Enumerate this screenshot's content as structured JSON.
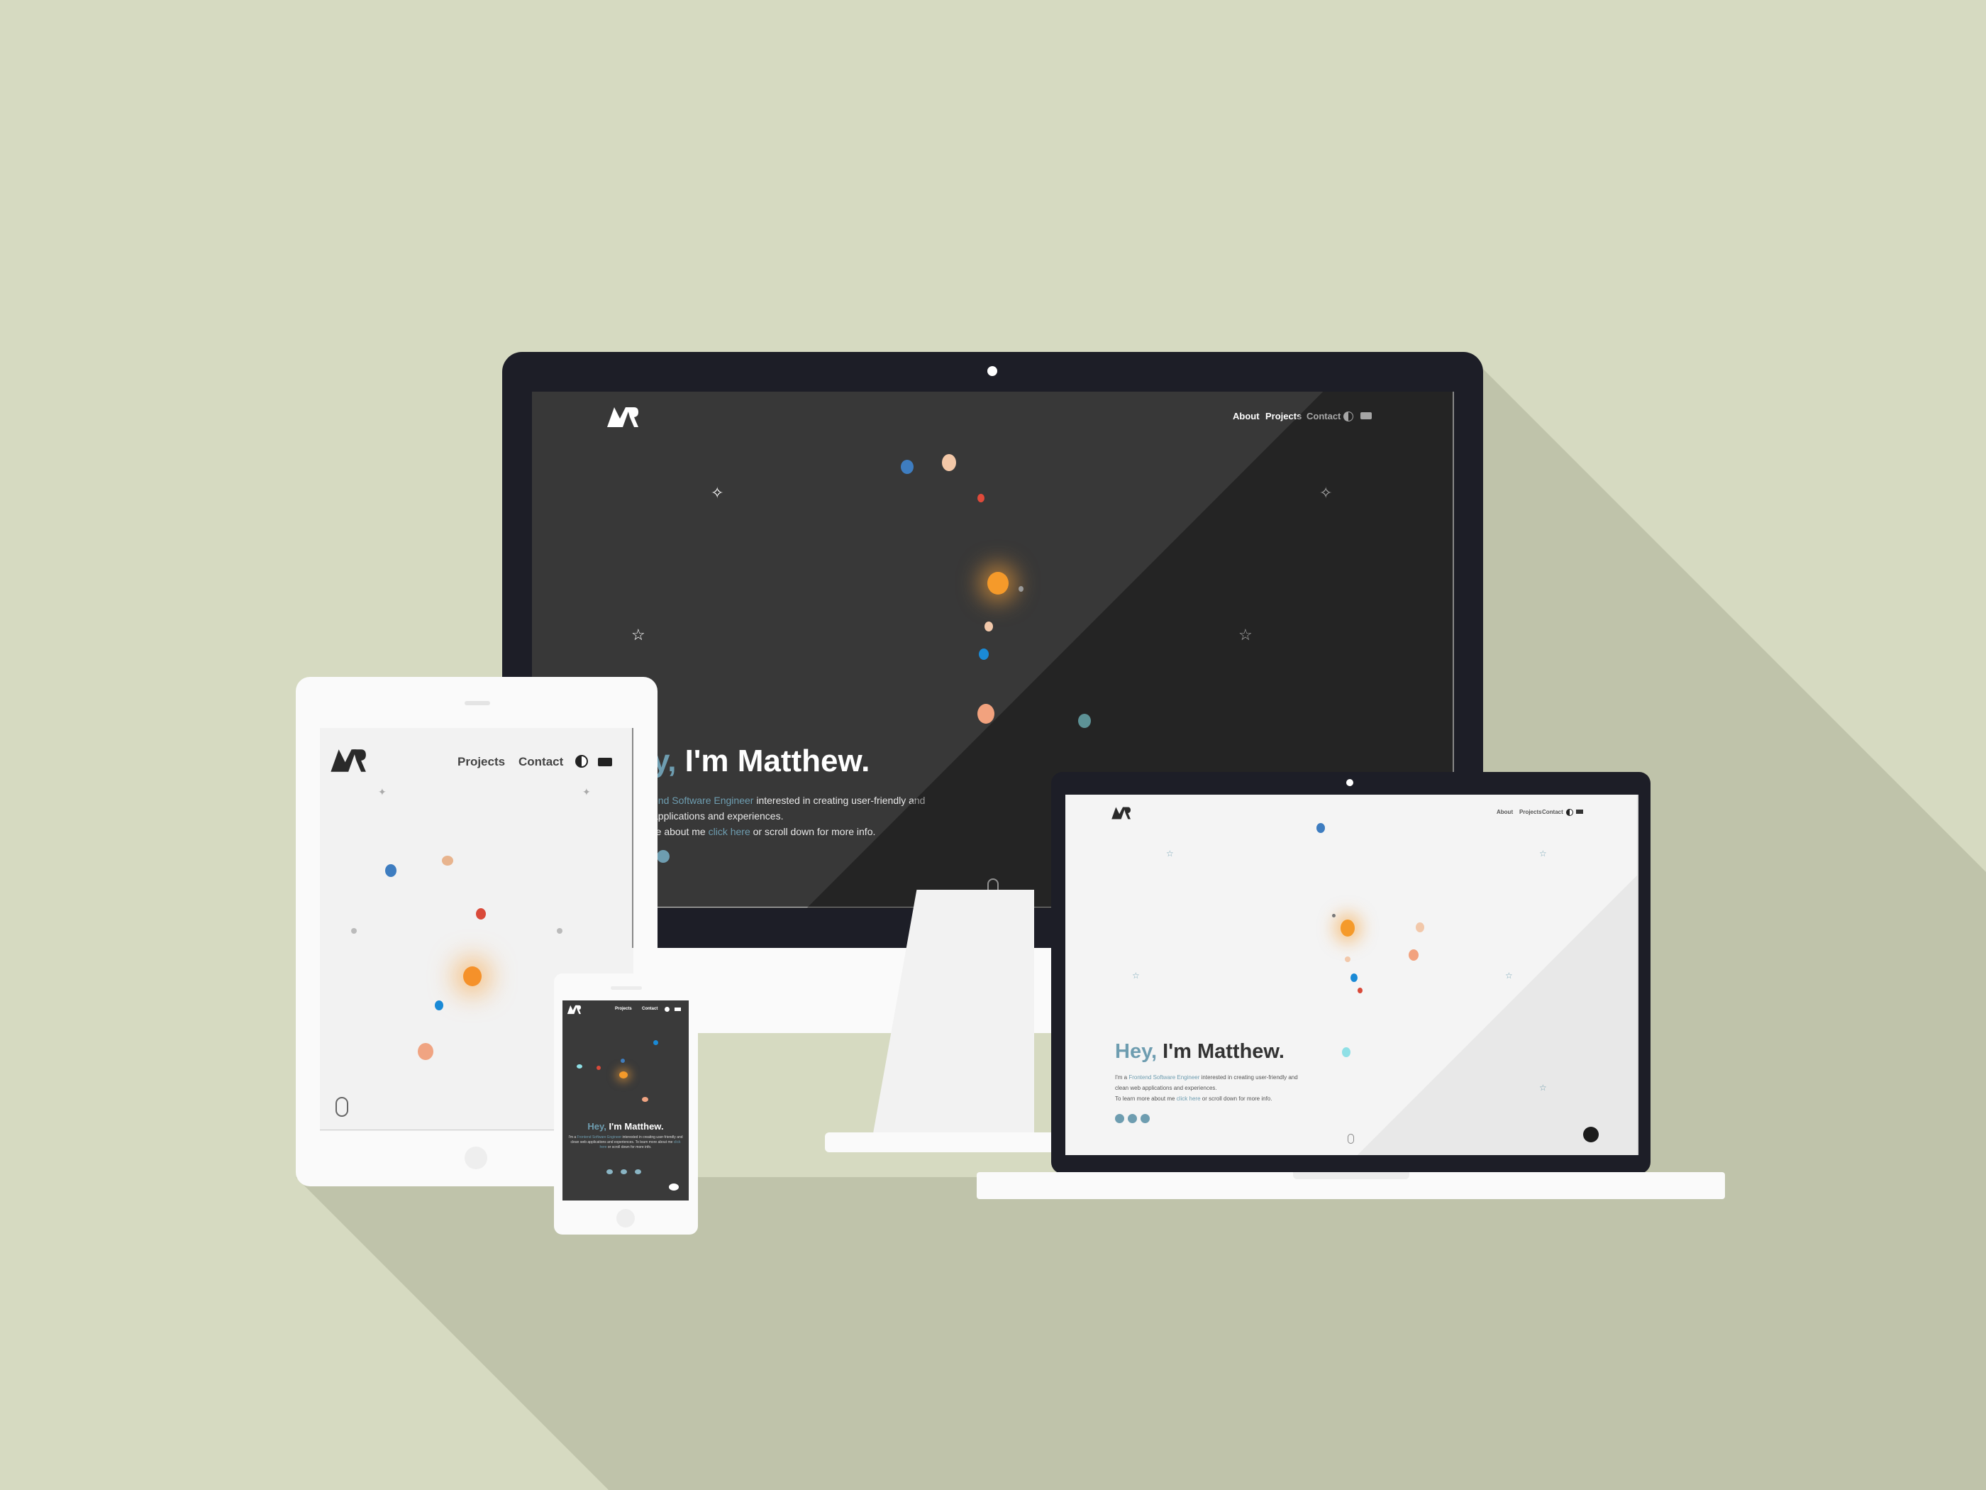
{
  "colors": {
    "background": "#d6dac1",
    "shadow": "#bfc3aa",
    "bezel": "#1d1e27",
    "accent": "#6e9db0",
    "sun": "#f7a13a"
  },
  "logo": {
    "text": "MR"
  },
  "nav": {
    "about": "About",
    "projects": "Projects",
    "contact": "Contact",
    "theme_icon": "contrast-icon",
    "lang_icon": "language-icon"
  },
  "hero": {
    "greeting": "Hey,",
    "name": "I'm Matthew.",
    "line1_prefix": "I'm a",
    "role": "Frontend Software Engineer",
    "line1_suffix": "interested in creating user-friendly and",
    "line2": "clean web applications and experiences.",
    "line3_prefix": "To learn more about me",
    "link": "click here",
    "line3_suffix": "or scroll down for more info."
  },
  "monitor_hero": {
    "greeting_partial": "y,",
    "line1_prefix": "",
    "role_partial": "end Software Engineer",
    "line2_partial": "applications and experiences.",
    "line3_prefix_partial": "re about me"
  }
}
